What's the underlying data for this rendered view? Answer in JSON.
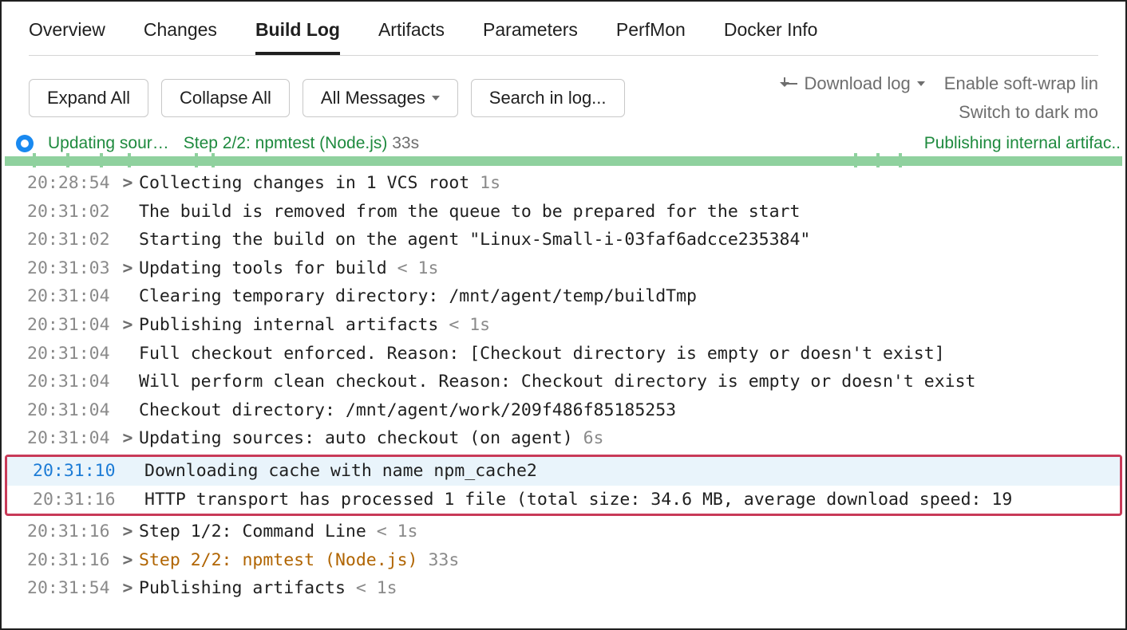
{
  "tabs": {
    "overview": "Overview",
    "changes": "Changes",
    "build_log": "Build Log",
    "artifacts": "Artifacts",
    "parameters": "Parameters",
    "perfmon": "PerfMon",
    "docker_info": "Docker Info"
  },
  "toolbar": {
    "expand_all": "Expand All",
    "collapse_all": "Collapse All",
    "all_messages": "All Messages",
    "search_placeholder": "Search in log...",
    "download_log": "Download log",
    "softwrap": "Enable soft-wrap lin",
    "darkmode": "Switch to dark mo"
  },
  "timeline": {
    "updating": "Updating sour…",
    "step": "Step 2/2: npmtest (Node.js)",
    "step_dur": "33s",
    "publishing": "Publishing internal artifac.."
  },
  "log": [
    {
      "ts": "20:28:54",
      "expandable": true,
      "msg": "Collecting changes in 1 VCS root",
      "dur": "1s"
    },
    {
      "ts": "20:31:02",
      "expandable": false,
      "msg": "The build is removed from the queue to be prepared for the start"
    },
    {
      "ts": "20:31:02",
      "expandable": false,
      "msg": "Starting the build on the agent \"Linux-Small-i-03faf6adcce235384\""
    },
    {
      "ts": "20:31:03",
      "expandable": true,
      "msg": "Updating tools for build",
      "dur": "< 1s"
    },
    {
      "ts": "20:31:04",
      "expandable": false,
      "msg": "Clearing temporary directory: /mnt/agent/temp/buildTmp"
    },
    {
      "ts": "20:31:04",
      "expandable": true,
      "msg": "Publishing internal artifacts",
      "dur": "< 1s"
    },
    {
      "ts": "20:31:04",
      "expandable": false,
      "msg": "Full checkout enforced. Reason: [Checkout directory is empty or doesn't exist]"
    },
    {
      "ts": "20:31:04",
      "expandable": false,
      "msg": "Will perform clean checkout. Reason: Checkout directory is empty or doesn't exist"
    },
    {
      "ts": "20:31:04",
      "expandable": false,
      "msg": "Checkout directory: /mnt/agent/work/209f486f85185253"
    },
    {
      "ts": "20:31:04",
      "expandable": true,
      "msg": "Updating sources: auto checkout (on agent)",
      "dur": "6s"
    },
    {
      "ts": "20:31:10",
      "expandable": false,
      "msg": "Downloading cache with name npm_cache2",
      "highlight": true,
      "ts_blue": true
    },
    {
      "ts": "20:31:16",
      "expandable": false,
      "msg": "HTTP transport has processed 1 file (total size: 34.6 MB, average download speed: 19"
    },
    {
      "ts": "20:31:16",
      "expandable": true,
      "msg": "Step 1/2: Command Line",
      "dur": "< 1s"
    },
    {
      "ts": "20:31:16",
      "expandable": true,
      "msg_orange": "Step 2/2: npmtest (Node.js)",
      "dur": "33s"
    },
    {
      "ts": "20:31:54",
      "expandable": true,
      "msg": "Publishing artifacts",
      "dur": "< 1s"
    }
  ]
}
